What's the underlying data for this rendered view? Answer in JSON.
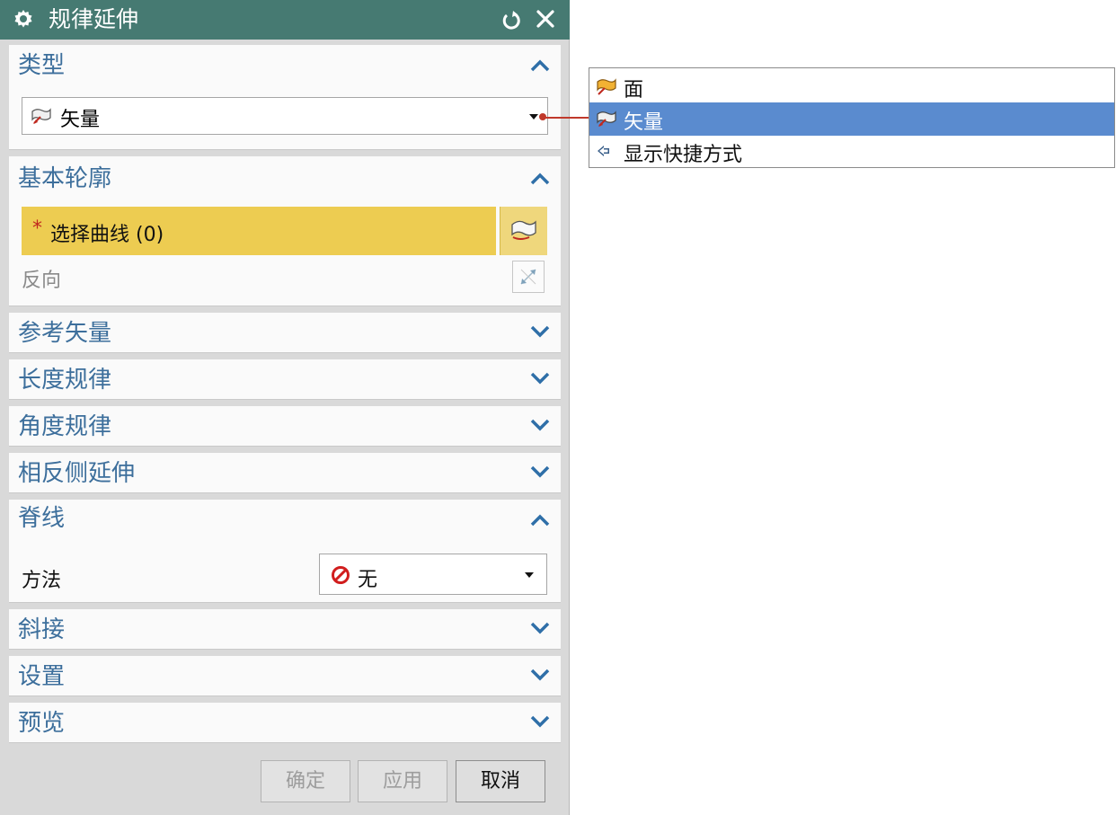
{
  "dialog": {
    "title": "规律延伸",
    "colors": {
      "titlebar": "#467a72",
      "section_title": "#3d6f9c",
      "selection_highlight": "#edcc51",
      "selected_option": "#5a8bcf"
    }
  },
  "sections": {
    "type": {
      "title": "类型",
      "expanded": true,
      "value": "矢量",
      "value_icon": "vector-icon"
    },
    "base_profile": {
      "title": "基本轮廓",
      "expanded": true,
      "select_label": "选择曲线 (0)",
      "required_marker": "*",
      "reverse_label": "反向"
    },
    "ref_vector": {
      "title": "参考矢量",
      "expanded": false
    },
    "length_law": {
      "title": "长度规律",
      "expanded": false
    },
    "angle_law": {
      "title": "角度规律",
      "expanded": false
    },
    "opposite_side": {
      "title": "相反侧延伸",
      "expanded": false
    },
    "spine": {
      "title": "脊线",
      "expanded": true,
      "method_label": "方法",
      "method_value": "无",
      "method_icon": "none-icon"
    },
    "miter": {
      "title": "斜接",
      "expanded": false
    },
    "settings": {
      "title": "设置",
      "expanded": false
    },
    "preview": {
      "title": "预览",
      "expanded": false
    }
  },
  "buttons": {
    "ok": "确定",
    "apply": "应用",
    "cancel": "取消"
  },
  "dropdown": {
    "options": [
      {
        "label": "面",
        "icon": "face-icon",
        "selected": false
      },
      {
        "label": "矢量",
        "icon": "vector-icon",
        "selected": true
      },
      {
        "label": "显示快捷方式",
        "icon": "arrow-left-icon",
        "selected": false
      }
    ]
  }
}
